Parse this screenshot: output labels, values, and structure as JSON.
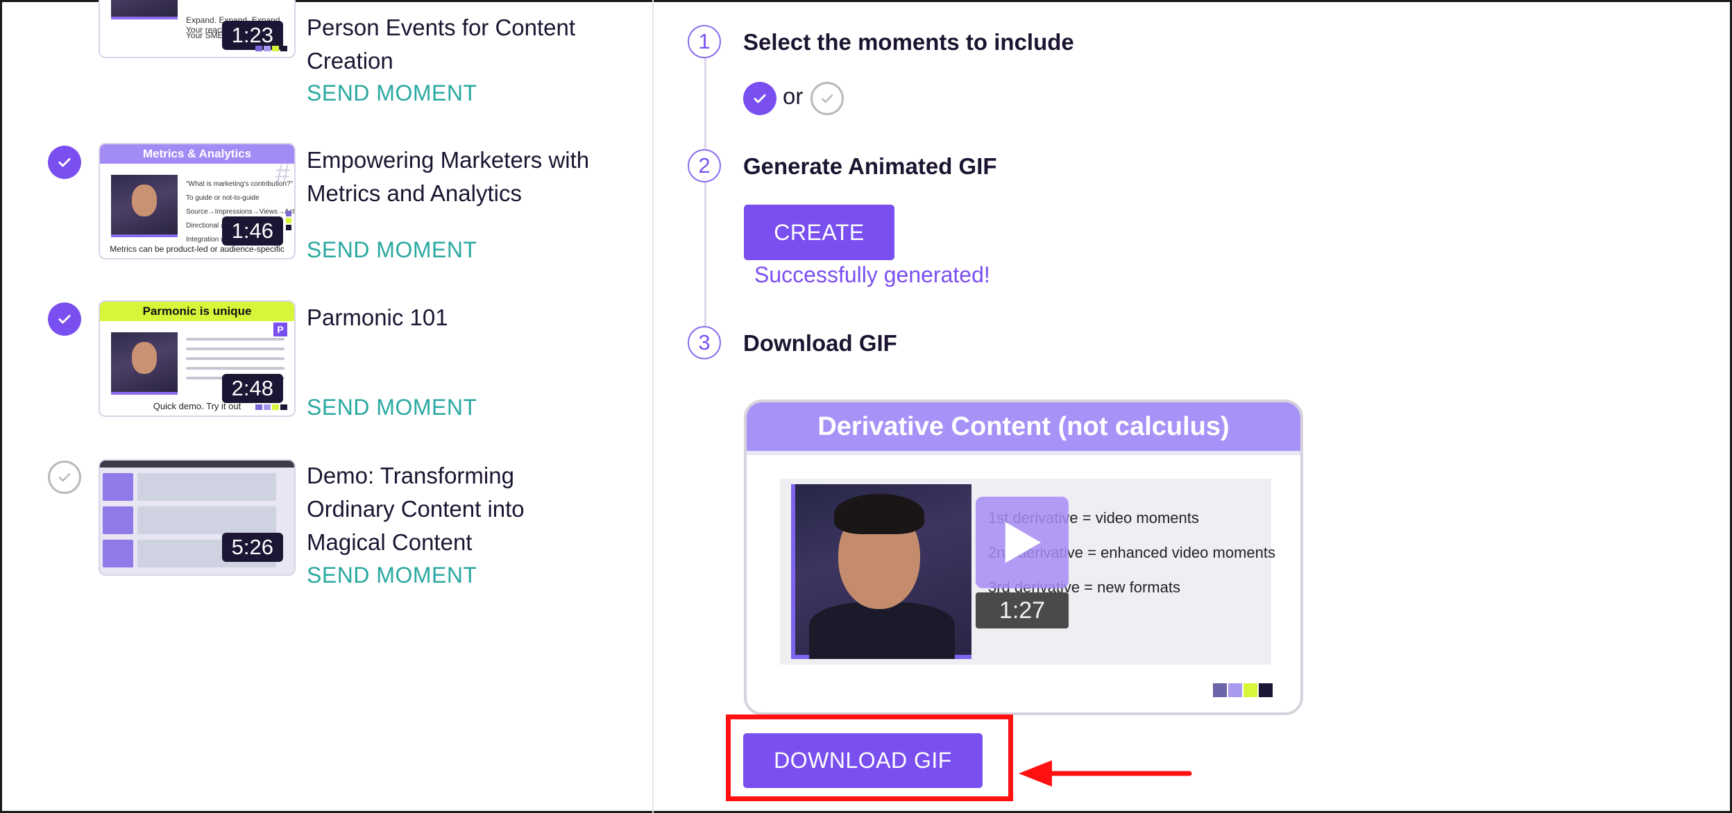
{
  "colors": {
    "accent": "#7a4ff0",
    "teal": "#2aa8a0",
    "highlight": "#ff1111"
  },
  "moments": [
    {
      "checked": null,
      "thumb_heading": "",
      "thumb_caption": "Expand. Expand. Expand. Your reach",
      "thumb_caption2": "Your SMEs",
      "duration": "1:23",
      "title_lines": [
        "Person Events for Content",
        "Creation"
      ],
      "send_label": "SEND MOMENT"
    },
    {
      "checked": true,
      "thumb_heading": "Metrics & Analytics",
      "thumb_text": [
        "\"What is marketing's contribution?\"",
        "To guide or not-to-guide",
        "Source→Impressions→Views→Actions",
        "Directional and",
        "Integration w"
      ],
      "thumb_caption": "Metrics can be product-led or audience-specific",
      "duration": "1:46",
      "title_lines": [
        "Empowering Marketers with",
        "Metrics and Analytics"
      ],
      "send_label": "SEND MOMENT"
    },
    {
      "checked": true,
      "thumb_heading": "Parmonic is unique",
      "thumb_caption": "Quick demo. Try it out",
      "duration": "2:48",
      "title_lines": [
        "Parmonic 101"
      ],
      "send_label": "SEND MOMENT"
    },
    {
      "checked": false,
      "thumb_heading": "",
      "duration": "5:26",
      "title_lines": [
        "Demo: Transforming",
        "Ordinary Content into",
        "Magical Content"
      ],
      "send_label": "SEND MOMENT"
    }
  ],
  "steps": [
    {
      "number": "1",
      "title": "Select the moments to include",
      "or_text": "or"
    },
    {
      "number": "2",
      "title": "Generate Animated GIF",
      "button_label": "CREATE",
      "status": "Successfully generated!"
    },
    {
      "number": "3",
      "title": "Download GIF",
      "button_label": "DOWNLOAD GIF"
    }
  ],
  "preview": {
    "heading": "Derivative Content (not calculus)",
    "lines": [
      "1st derivative = video moments",
      "2nd derivative = enhanced video moments",
      "3rd derivative = new formats"
    ],
    "duration": "1:27"
  },
  "icons": [
    "check-icon",
    "play-icon",
    "arrow-left-icon"
  ]
}
